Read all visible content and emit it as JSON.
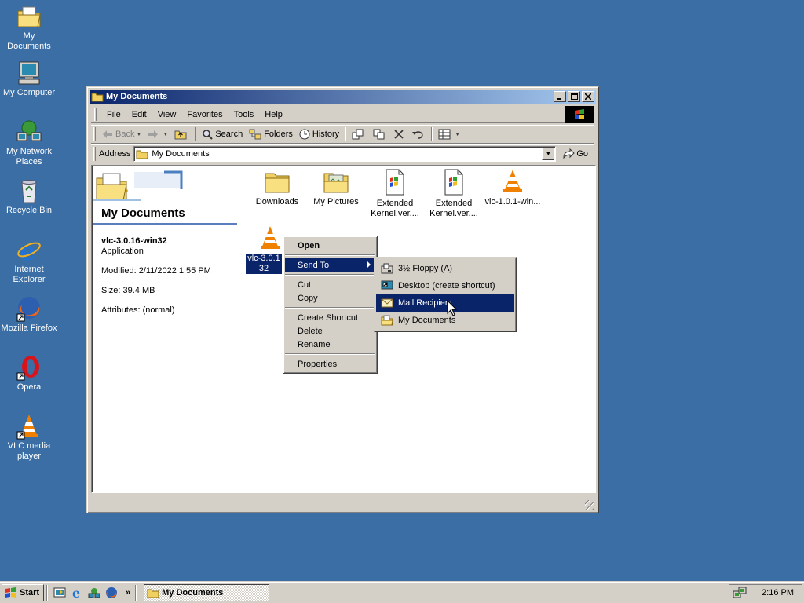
{
  "desktop": {
    "icons": [
      {
        "label": "My Documents"
      },
      {
        "label": "My Computer"
      },
      {
        "label": "My Network Places"
      },
      {
        "label": "Recycle Bin"
      },
      {
        "label": "Internet Explorer"
      },
      {
        "label": "Mozilla Firefox"
      },
      {
        "label": "Opera"
      },
      {
        "label": "VLC media player"
      }
    ]
  },
  "window": {
    "title": "My Documents",
    "menu": [
      "File",
      "Edit",
      "View",
      "Favorites",
      "Tools",
      "Help"
    ],
    "toolbar": {
      "back": "Back",
      "search": "Search",
      "folders": "Folders",
      "history": "History"
    },
    "address": {
      "label": "Address",
      "value": "My Documents",
      "go": "Go"
    },
    "panel": {
      "title": "My Documents",
      "selected_name": "vlc-3.0.16-win32",
      "selected_type": "Application",
      "modified": "Modified: 2/11/2022 1:55 PM",
      "size": "Size: 39.4 MB",
      "attributes": "Attributes: (normal)"
    },
    "files": [
      {
        "label": "Downloads"
      },
      {
        "label": "My Pictures"
      },
      {
        "label": "Extended Kernel.ver...."
      },
      {
        "label": "Extended Kernel.ver...."
      },
      {
        "label": "vlc-1.0.1-win..."
      },
      {
        "label": "vlc-3.0.1 32"
      }
    ]
  },
  "context_menu": {
    "items": [
      "Open",
      "Send To",
      "Cut",
      "Copy",
      "Create Shortcut",
      "Delete",
      "Rename",
      "Properties"
    ]
  },
  "send_to_menu": {
    "items": [
      "3½ Floppy (A)",
      "Desktop (create shortcut)",
      "Mail Recipient",
      "My Documents"
    ]
  },
  "taskbar": {
    "start": "Start",
    "chevron": "»",
    "task": "My Documents",
    "clock": "2:16 PM"
  },
  "colors": {
    "desktop": "#3a6ea5",
    "title_active": "#0a246a",
    "highlight": "#0a246a",
    "face": "#d4d0c8"
  }
}
